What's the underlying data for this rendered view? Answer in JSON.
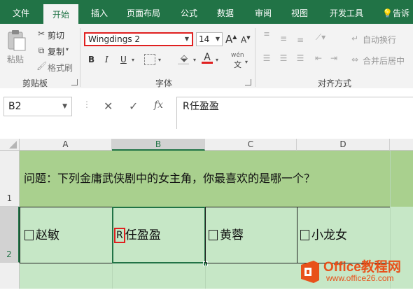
{
  "tabs": [
    "文件",
    "开始",
    "插入",
    "页面布局",
    "公式",
    "数据",
    "审阅",
    "视图",
    "开发工具"
  ],
  "tell_me": "告诉",
  "ribbon": {
    "clipboard": {
      "paste": "粘贴",
      "cut": "剪切",
      "copy": "复制",
      "format_painter": "格式刷",
      "label": "剪贴板"
    },
    "font": {
      "name": "Wingdings 2",
      "size": "14",
      "bold": "B",
      "italic": "I",
      "underline": "U",
      "font_color": "A",
      "wen": "文",
      "label": "字体"
    },
    "alignment": {
      "wrap_text": "自动换行",
      "merge_center": "合并后居中",
      "label": "对齐方式"
    }
  },
  "formula_bar": {
    "name_box": "B2",
    "cancel": "✕",
    "enter": "✓",
    "fx": "fx",
    "content": "R任盈盈"
  },
  "sheet": {
    "columns": [
      "A",
      "B",
      "C",
      "D"
    ],
    "rows": [
      "1",
      "2"
    ],
    "row1_text": "问题：下列金庸武侠剧中的女主角，你最喜欢的是哪一个？",
    "row2": [
      {
        "checkbox": "☐",
        "name": "赵敏"
      },
      {
        "checkbox": "R",
        "name": "任盈盈"
      },
      {
        "checkbox": "☐",
        "name": "黄蓉"
      },
      {
        "checkbox": "☐",
        "name": "小龙女"
      }
    ]
  },
  "watermark": {
    "brand": "Office教程网",
    "url": "www.office26.com"
  },
  "colors": {
    "ribbon_green": "#217346",
    "header_fill": "#a9d08e",
    "cell_fill": "#c6e7c6",
    "highlight_red": "#e02020"
  }
}
